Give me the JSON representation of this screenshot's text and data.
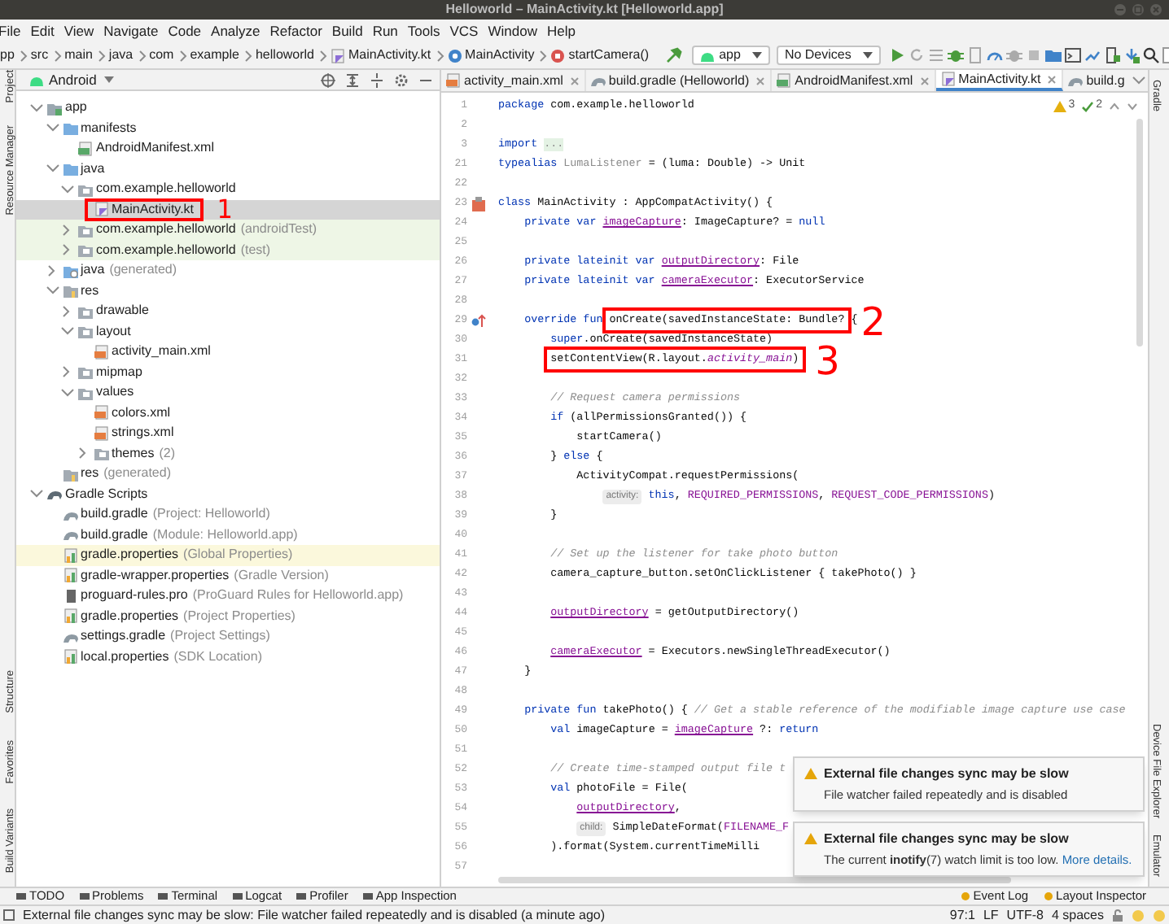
{
  "window": {
    "title": "Helloworld – MainActivity.kt [Helloworld.app]"
  },
  "menu": [
    "File",
    "Edit",
    "View",
    "Navigate",
    "Code",
    "Analyze",
    "Refactor",
    "Build",
    "Run",
    "Tools",
    "VCS",
    "Window",
    "Help"
  ],
  "breadcrumbs": [
    {
      "label": "pp",
      "kind": "plain"
    },
    {
      "label": "src",
      "kind": "plain"
    },
    {
      "label": "main",
      "kind": "plain"
    },
    {
      "label": "java",
      "kind": "plain"
    },
    {
      "label": "com",
      "kind": "plain"
    },
    {
      "label": "example",
      "kind": "plain"
    },
    {
      "label": "helloworld",
      "kind": "plain"
    },
    {
      "label": "MainActivity.kt",
      "kind": "kotlin"
    },
    {
      "label": "MainActivity",
      "kind": "class"
    },
    {
      "label": "startCamera()",
      "kind": "method"
    }
  ],
  "toolbar": {
    "run_config": "app",
    "device": "No Devices"
  },
  "project_panel": {
    "view": "Android",
    "tree": [
      {
        "label": "app",
        "kind": "module",
        "expanded": true,
        "selected": false,
        "children": [
          {
            "label": "manifests",
            "kind": "folder",
            "expanded": true,
            "selected": false,
            "children": [
              {
                "label": "AndroidManifest.xml",
                "kind": "manifest",
                "selected": false
              }
            ]
          },
          {
            "label": "java",
            "kind": "folder",
            "expanded": true,
            "selected": false,
            "children": [
              {
                "label": "com.example.helloworld",
                "kind": "package",
                "expanded": true,
                "selected": false,
                "children": [
                  {
                    "label": "MainActivity.kt",
                    "kind": "kotlin",
                    "selected": true,
                    "callout": "1"
                  }
                ]
              },
              {
                "label": "com.example.helloworld",
                "note": "(androidTest)",
                "kind": "package",
                "expanded": false,
                "selected": false,
                "color": "#eef6e6"
              },
              {
                "label": "com.example.helloworld",
                "note": "(test)",
                "kind": "package",
                "expanded": false,
                "selected": false,
                "color": "#eef6e6"
              }
            ]
          },
          {
            "label": "java",
            "note": "(generated)",
            "kind": "generated",
            "expanded": false,
            "selected": false
          },
          {
            "label": "res",
            "kind": "res",
            "expanded": true,
            "selected": false,
            "children": [
              {
                "label": "drawable",
                "kind": "package",
                "expanded": false,
                "selected": false
              },
              {
                "label": "layout",
                "kind": "package",
                "expanded": true,
                "selected": false,
                "children": [
                  {
                    "label": "activity_main.xml",
                    "kind": "xml",
                    "selected": false
                  }
                ]
              },
              {
                "label": "mipmap",
                "kind": "package",
                "expanded": false,
                "selected": false
              },
              {
                "label": "values",
                "kind": "package",
                "expanded": true,
                "selected": false,
                "children": [
                  {
                    "label": "colors.xml",
                    "kind": "xml",
                    "selected": false
                  },
                  {
                    "label": "strings.xml",
                    "kind": "xml",
                    "selected": false
                  },
                  {
                    "label": "themes",
                    "note": "(2)",
                    "kind": "package",
                    "expanded": false,
                    "selected": false
                  }
                ]
              }
            ]
          },
          {
            "label": "res",
            "note": "(generated)",
            "kind": "res",
            "selected": false
          }
        ]
      },
      {
        "label": "Gradle Scripts",
        "kind": "gradle-scripts",
        "expanded": true,
        "selected": false,
        "children": [
          {
            "label": "build.gradle",
            "note": "(Project: Helloworld)",
            "kind": "gradle",
            "selected": false
          },
          {
            "label": "build.gradle",
            "note": "(Module: Helloworld.app)",
            "kind": "gradle",
            "selected": false
          },
          {
            "label": "gradle.properties",
            "note": "(Global Properties)",
            "kind": "properties",
            "selected": false,
            "color": "#fbf8dc"
          },
          {
            "label": "gradle-wrapper.properties",
            "note": "(Gradle Version)",
            "kind": "properties",
            "selected": false
          },
          {
            "label": "proguard-rules.pro",
            "note": "(ProGuard Rules for Helloworld.app)",
            "kind": "file",
            "selected": false
          },
          {
            "label": "gradle.properties",
            "note": "(Project Properties)",
            "kind": "properties",
            "selected": false
          },
          {
            "label": "settings.gradle",
            "note": "(Project Settings)",
            "kind": "gradle",
            "selected": false
          },
          {
            "label": "local.properties",
            "note": "(SDK Location)",
            "kind": "properties",
            "selected": false
          }
        ]
      }
    ]
  },
  "editor": {
    "tabs": [
      {
        "label": "activity_main.xml",
        "kind": "xml",
        "selected": false
      },
      {
        "label": "build.gradle (Helloworld)",
        "kind": "gradle",
        "selected": false
      },
      {
        "label": "AndroidManifest.xml",
        "kind": "manifest",
        "selected": false
      },
      {
        "label": "MainActivity.kt",
        "kind": "kotlin",
        "selected": true
      },
      {
        "label": "build.g",
        "kind": "gradle",
        "selected": false
      }
    ],
    "inspections": {
      "warnings": "3",
      "weak_warnings": "2"
    },
    "lines": [
      {
        "number": "1",
        "tokens": [
          {
            "text": "package",
            "kind": "kw"
          },
          {
            "text": " com.example.helloworld",
            "kind": "plain"
          }
        ]
      },
      {
        "number": "2"
      },
      {
        "number": "3",
        "tokens": [
          {
            "text": "import ",
            "kind": "kw"
          },
          {
            "text": "...",
            "kind": "folded"
          }
        ]
      },
      {
        "number": "21",
        "tokens": [
          {
            "text": "typealias ",
            "kind": "kw"
          },
          {
            "text": "LumaListener",
            "kind": "unused"
          },
          {
            "text": " = (luma: Double) -> Unit",
            "kind": "plain"
          }
        ]
      },
      {
        "number": "22"
      },
      {
        "number": "23",
        "marker": {
          "kind": "class"
        },
        "tokens": [
          {
            "text": "class",
            "kind": "kw"
          },
          {
            "text": " MainActivity : AppCompatActivity() {",
            "kind": "plain"
          }
        ]
      },
      {
        "number": "24",
        "tokens": [
          {
            "text": "    private var ",
            "kind": "kw"
          },
          {
            "text": "imageCapture",
            "kind": "prop"
          },
          {
            "text": ": ImageCapture? = ",
            "kind": "plain"
          },
          {
            "text": "null",
            "kind": "kw"
          }
        ]
      },
      {
        "number": "25"
      },
      {
        "number": "26",
        "tokens": [
          {
            "text": "    private lateinit var ",
            "kind": "kw"
          },
          {
            "text": "outputDirectory",
            "kind": "prop"
          },
          {
            "text": ": File",
            "kind": "plain"
          }
        ]
      },
      {
        "number": "27",
        "tokens": [
          {
            "text": "    private lateinit var ",
            "kind": "kw"
          },
          {
            "text": "cameraExecutor",
            "kind": "prop"
          },
          {
            "text": ": ExecutorService",
            "kind": "plain"
          }
        ]
      },
      {
        "number": "28"
      },
      {
        "number": "29",
        "marker": {
          "kind": "override"
        },
        "tokens": [
          {
            "text": "    override fun ",
            "kind": "kw"
          },
          {
            "callout": "2",
            "tokens": [
              {
                "text": "onCreate(savedInstanceState: Bundle?",
                "kind": "plain"
              }
            ]
          },
          {
            "text": " {",
            "kind": "plain"
          }
        ]
      },
      {
        "number": "30",
        "tokens": [
          {
            "text": "        super",
            "kind": "kw"
          },
          {
            "text": ".onCreate(savedInstanceState)",
            "kind": "plain"
          }
        ]
      },
      {
        "number": "31",
        "tokens": [
          {
            "callout": "3",
            "tokens": [
              {
                "text": "        setContentView(R.layout.",
                "kind": "plain"
              },
              {
                "text": "activity_main",
                "kind": "resource"
              },
              {
                "text": ")",
                "kind": "plain"
              }
            ]
          }
        ]
      },
      {
        "number": "32"
      },
      {
        "number": "33",
        "tokens": [
          {
            "text": "        // Request camera permissions",
            "kind": "comment"
          }
        ]
      },
      {
        "number": "34",
        "tokens": [
          {
            "text": "        if",
            "kind": "kw"
          },
          {
            "text": " (allPermissionsGranted()) {",
            "kind": "plain"
          }
        ]
      },
      {
        "number": "35",
        "tokens": [
          {
            "text": "            startCamera()",
            "kind": "plain"
          }
        ]
      },
      {
        "number": "36",
        "tokens": [
          {
            "text": "        } ",
            "kind": "plain"
          },
          {
            "text": "else",
            "kind": "kw"
          },
          {
            "text": " {",
            "kind": "plain"
          }
        ]
      },
      {
        "number": "37",
        "tokens": [
          {
            "text": "            ActivityCompat.requestPermissions(",
            "kind": "plain"
          }
        ]
      },
      {
        "number": "38",
        "tokens": [
          {
            "text": "                activity:",
            "kind": "hint"
          },
          {
            "text": " this",
            "kind": "kw"
          },
          {
            "text": ", ",
            "kind": "plain"
          },
          {
            "text": "REQUIRED_PERMISSIONS",
            "kind": "const"
          },
          {
            "text": ", ",
            "kind": "plain"
          },
          {
            "text": "REQUEST_CODE_PERMISSIONS",
            "kind": "const"
          },
          {
            "text": ")",
            "kind": "plain"
          }
        ]
      },
      {
        "number": "39",
        "tokens": [
          {
            "text": "        }",
            "kind": "plain"
          }
        ]
      },
      {
        "number": "40"
      },
      {
        "number": "41",
        "tokens": [
          {
            "text": "        // Set up the listener for take photo button",
            "kind": "comment"
          }
        ]
      },
      {
        "number": "42",
        "tokens": [
          {
            "text": "        camera_capture_button.setOnClickListener { takePhoto() }",
            "kind": "plain"
          }
        ]
      },
      {
        "number": "43"
      },
      {
        "number": "44",
        "tokens": [
          {
            "text": "        outputDirectory",
            "kind": "prop"
          },
          {
            "text": " = getOutputDirectory()",
            "kind": "plain"
          }
        ]
      },
      {
        "number": "45"
      },
      {
        "number": "46",
        "tokens": [
          {
            "text": "        cameraExecutor",
            "kind": "prop"
          },
          {
            "text": " = Executors.newSingleThreadExecutor()",
            "kind": "plain"
          }
        ]
      },
      {
        "number": "47",
        "tokens": [
          {
            "text": "    }",
            "kind": "plain"
          }
        ]
      },
      {
        "number": "48"
      },
      {
        "number": "49",
        "tokens": [
          {
            "text": "    private fun",
            "kind": "kw"
          },
          {
            "text": " takePhoto() { ",
            "kind": "plain"
          },
          {
            "text": "// Get a stable reference of the modifiable image capture use case",
            "kind": "comment"
          }
        ]
      },
      {
        "number": "50",
        "tokens": [
          {
            "text": "        val",
            "kind": "kw"
          },
          {
            "text": " imageCapture = ",
            "kind": "plain"
          },
          {
            "text": "imageCapture",
            "kind": "prop"
          },
          {
            "text": " ?: ",
            "kind": "plain"
          },
          {
            "text": "return",
            "kind": "kw"
          }
        ]
      },
      {
        "number": "51"
      },
      {
        "number": "52",
        "tokens": [
          {
            "text": "        // Create time-stamped output file t",
            "kind": "comment"
          }
        ]
      },
      {
        "number": "53",
        "tokens": [
          {
            "text": "        val",
            "kind": "kw"
          },
          {
            "text": " photoFile = File(",
            "kind": "plain"
          }
        ]
      },
      {
        "number": "54",
        "tokens": [
          {
            "text": "            outputDirectory",
            "kind": "prop"
          },
          {
            "text": ",",
            "kind": "plain"
          }
        ]
      },
      {
        "number": "55",
        "tokens": [
          {
            "text": "            child:",
            "kind": "hint"
          },
          {
            "text": " SimpleDateFormat(",
            "kind": "plain"
          },
          {
            "text": "FILENAME_F",
            "kind": "const"
          }
        ]
      },
      {
        "number": "56",
        "tokens": [
          {
            "text": "        ).format(System.currentTimeMilli",
            "kind": "plain"
          }
        ]
      },
      {
        "number": "57"
      }
    ]
  },
  "notifications": [
    {
      "title": "External file changes sync may be slow",
      "body": "File watcher failed repeatedly and is disabled"
    },
    {
      "title": "External file changes sync may be slow",
      "body": "The current **inotify**(7) watch limit is too low.",
      "link": "More details."
    }
  ],
  "left_tool_windows": {
    "top": [
      "Project",
      "Resource Manager"
    ],
    "bottom": [
      "Structure",
      "Favorites",
      "Build Variants"
    ]
  },
  "right_tool_windows": {
    "top": [
      "Gradle"
    ],
    "bottom": [
      "Device File Explorer",
      "Emulator"
    ]
  },
  "bottom_tool_windows": [
    "TODO",
    "Problems",
    "Terminal",
    "Logcat",
    "Profiler",
    "App Inspection"
  ],
  "bottom_tool_windows_right": [
    "Event Log",
    "Layout Inspector"
  ],
  "status_bar": {
    "message": "External file changes sync may be slow: File watcher failed repeatedly and is disabled (a minute ago)",
    "position": "97:1",
    "line_separator": "LF",
    "encoding": "UTF-8",
    "indent": "4 spaces"
  }
}
